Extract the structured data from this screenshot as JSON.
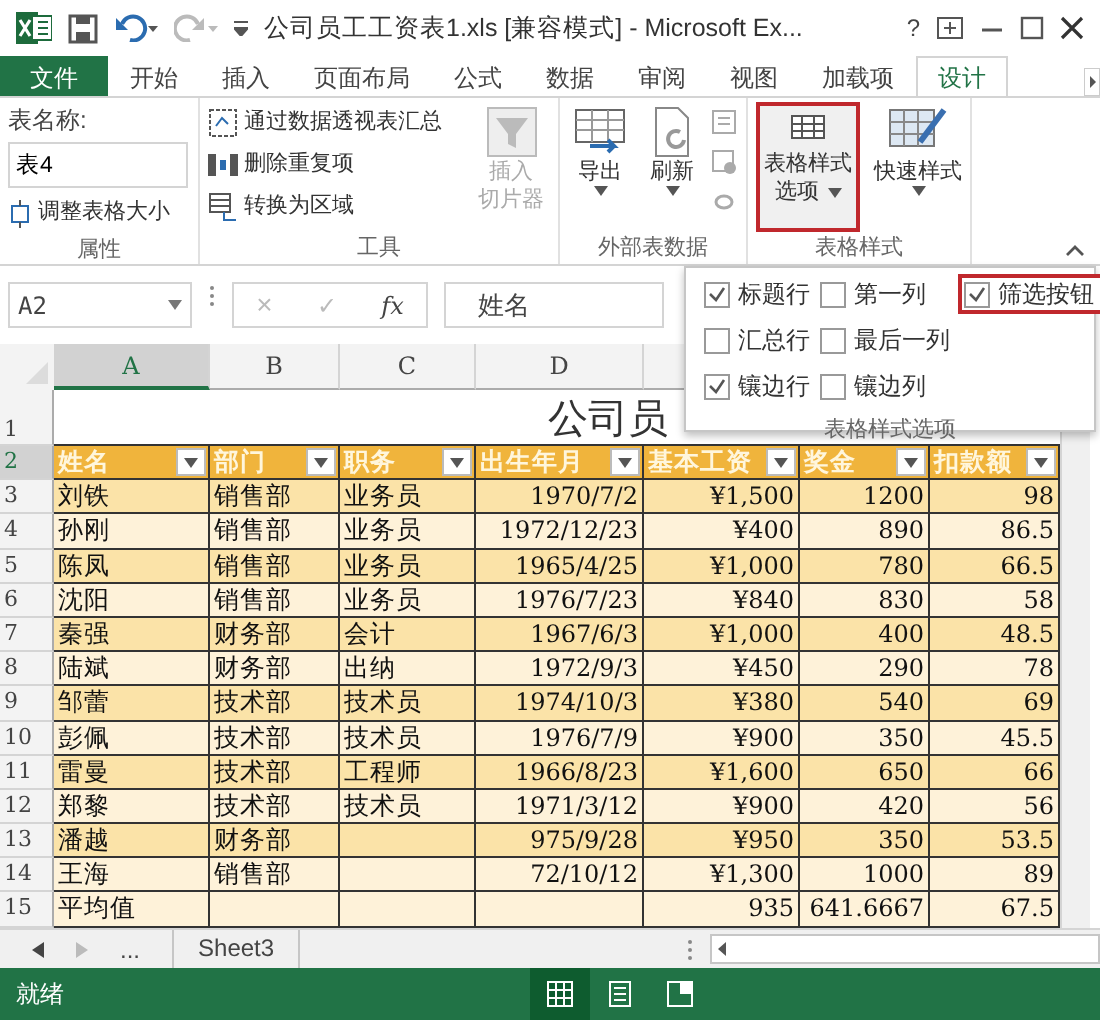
{
  "title_bar": {
    "title": "公司员工工资表1.xls  [兼容模式] - Microsoft Ex...",
    "help": "?"
  },
  "tabs": [
    {
      "label": "文件",
      "kind": "file",
      "selected": false
    },
    {
      "label": "开始",
      "kind": "tab",
      "selected": false
    },
    {
      "label": "插入",
      "kind": "tab",
      "selected": false
    },
    {
      "label": "页面布局",
      "kind": "tab",
      "selected": false
    },
    {
      "label": "公式",
      "kind": "tab",
      "selected": false
    },
    {
      "label": "数据",
      "kind": "tab",
      "selected": false
    },
    {
      "label": "审阅",
      "kind": "tab",
      "selected": false
    },
    {
      "label": "视图",
      "kind": "tab",
      "selected": false
    },
    {
      "label": "加载项",
      "kind": "tab",
      "selected": false
    },
    {
      "label": "设计",
      "kind": "tab",
      "selected": true
    }
  ],
  "ribbon": {
    "properties": {
      "label": "属性",
      "name_label": "表名称:",
      "table_name": "表4",
      "resize": "调整表格大小"
    },
    "tools": {
      "label": "工具",
      "items": [
        "通过数据透视表汇总",
        "删除重复项",
        "转换为区域"
      ],
      "slicer": {
        "lines": [
          "插入",
          "切片器"
        ],
        "disabled": true
      }
    },
    "external": {
      "label": "外部表数据",
      "items": [
        {
          "label": "导出",
          "disabled": false
        },
        {
          "label": "刷新",
          "disabled": false
        }
      ]
    },
    "styles": {
      "label": "表格样式",
      "options_button": {
        "lines": [
          "表格样式",
          "选项"
        ],
        "highlighted": true
      },
      "quick": "快速样式"
    }
  },
  "formula_bar": {
    "name_box": "A2",
    "cancel": "×",
    "enter": "✓",
    "fx": "fx",
    "value": "姓名"
  },
  "style_options": {
    "title": "表格样式选项",
    "options": [
      {
        "label": "标题行",
        "checked": true,
        "highlighted": false
      },
      {
        "label": "第一列",
        "checked": false,
        "highlighted": false
      },
      {
        "label": "筛选按钮",
        "checked": true,
        "highlighted": true
      },
      {
        "label": "汇总行",
        "checked": false,
        "highlighted": false
      },
      {
        "label": "最后一列",
        "checked": false,
        "highlighted": false
      },
      {
        "label": "镶边行",
        "checked": true,
        "highlighted": false
      },
      {
        "label": "镶边列",
        "checked": false,
        "highlighted": false
      }
    ]
  },
  "sheet": {
    "columns": [
      {
        "label": "A",
        "selected": true
      },
      {
        "label": "B",
        "selected": false
      },
      {
        "label": "C",
        "selected": false
      },
      {
        "label": "D",
        "selected": false
      },
      {
        "selected": false
      }
    ],
    "title": "公司员",
    "rows": [
      {
        "number": "1",
        "kind": "title",
        "selected": false
      },
      {
        "number": "2",
        "kind": "header",
        "selected": true,
        "cells": [
          "姓名",
          "部门",
          "职务",
          "出生年月",
          "基本工资",
          "奖金",
          "扣款额"
        ]
      },
      {
        "number": "3",
        "kind": "data",
        "selected": false,
        "cells": [
          "刘铁",
          "销售部",
          "业务员",
          "1970/7/2",
          "¥1,500",
          "1200",
          "98"
        ]
      },
      {
        "number": "4",
        "kind": "data",
        "selected": false,
        "cells": [
          "孙刚",
          "销售部",
          "业务员",
          "1972/12/23",
          "¥400",
          "890",
          "86.5"
        ]
      },
      {
        "number": "5",
        "kind": "data",
        "selected": false,
        "cells": [
          "陈凤",
          "销售部",
          "业务员",
          "1965/4/25",
          "¥1,000",
          "780",
          "66.5"
        ]
      },
      {
        "number": "6",
        "kind": "data",
        "selected": false,
        "cells": [
          "沈阳",
          "销售部",
          "业务员",
          "1976/7/23",
          "¥840",
          "830",
          "58"
        ]
      },
      {
        "number": "7",
        "kind": "data",
        "selected": false,
        "cells": [
          "秦强",
          "财务部",
          "会计",
          "1967/6/3",
          "¥1,000",
          "400",
          "48.5"
        ]
      },
      {
        "number": "8",
        "kind": "data",
        "selected": false,
        "cells": [
          "陆斌",
          "财务部",
          "出纳",
          "1972/9/3",
          "¥450",
          "290",
          "78"
        ]
      },
      {
        "number": "9",
        "kind": "data",
        "selected": false,
        "cells": [
          "邹蕾",
          "技术部",
          "技术员",
          "1974/10/3",
          "¥380",
          "540",
          "69"
        ]
      },
      {
        "number": "10",
        "kind": "data",
        "selected": false,
        "cells": [
          "彭佩",
          "技术部",
          "技术员",
          "1976/7/9",
          "¥900",
          "350",
          "45.5"
        ]
      },
      {
        "number": "11",
        "kind": "data",
        "selected": false,
        "cells": [
          "雷曼",
          "技术部",
          "工程师",
          "1966/8/23",
          "¥1,600",
          "650",
          "66"
        ]
      },
      {
        "number": "12",
        "kind": "data",
        "selected": false,
        "cells": [
          "郑黎",
          "技术部",
          "技术员",
          "1971/3/12",
          "¥900",
          "420",
          "56"
        ]
      },
      {
        "number": "13",
        "kind": "data",
        "selected": false,
        "cells": [
          "潘越",
          "财务部",
          null,
          "975/9/28",
          "¥950",
          "350",
          "53.5"
        ]
      },
      {
        "number": "14",
        "kind": "data",
        "selected": false,
        "cells": [
          "王海",
          "销售部",
          null,
          "72/10/12",
          "¥1,300",
          "1000",
          "89"
        ]
      },
      {
        "number": "15",
        "kind": "total",
        "selected": false,
        "cells": [
          "平均值",
          null,
          null,
          null,
          "935",
          "641.6667",
          "67.5"
        ]
      }
    ]
  },
  "sheet_tabs": {
    "more": "...",
    "tabs": [
      {
        "label": "Sheet3",
        "selected": false
      }
    ]
  },
  "status_bar": {
    "text": "就绪",
    "views": [
      {
        "kind": "normal",
        "selected": true
      },
      {
        "kind": "layout",
        "selected": false
      },
      {
        "kind": "pagebreak",
        "selected": false
      }
    ]
  }
}
